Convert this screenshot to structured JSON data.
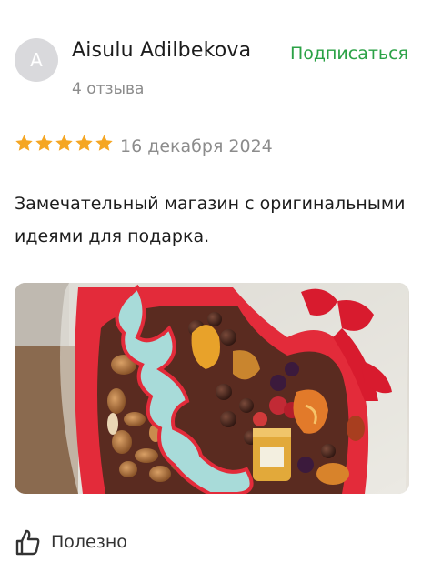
{
  "review": {
    "avatar_letter": "A",
    "author": "Aisulu Adilbekova",
    "reviews_count": "4 отзыва",
    "subscribe_label": "Подписаться",
    "rating": 5,
    "date": "16 декабря 2024",
    "text": "Замечательный магазин с оригинальными идеями для подарка.",
    "useful_label": "Полезно"
  },
  "colors": {
    "accent": "#2ba246",
    "star": "#f5a623",
    "muted": "#8c8c8c"
  },
  "icons": [
    "star-icon",
    "thumbs-up-icon"
  ]
}
